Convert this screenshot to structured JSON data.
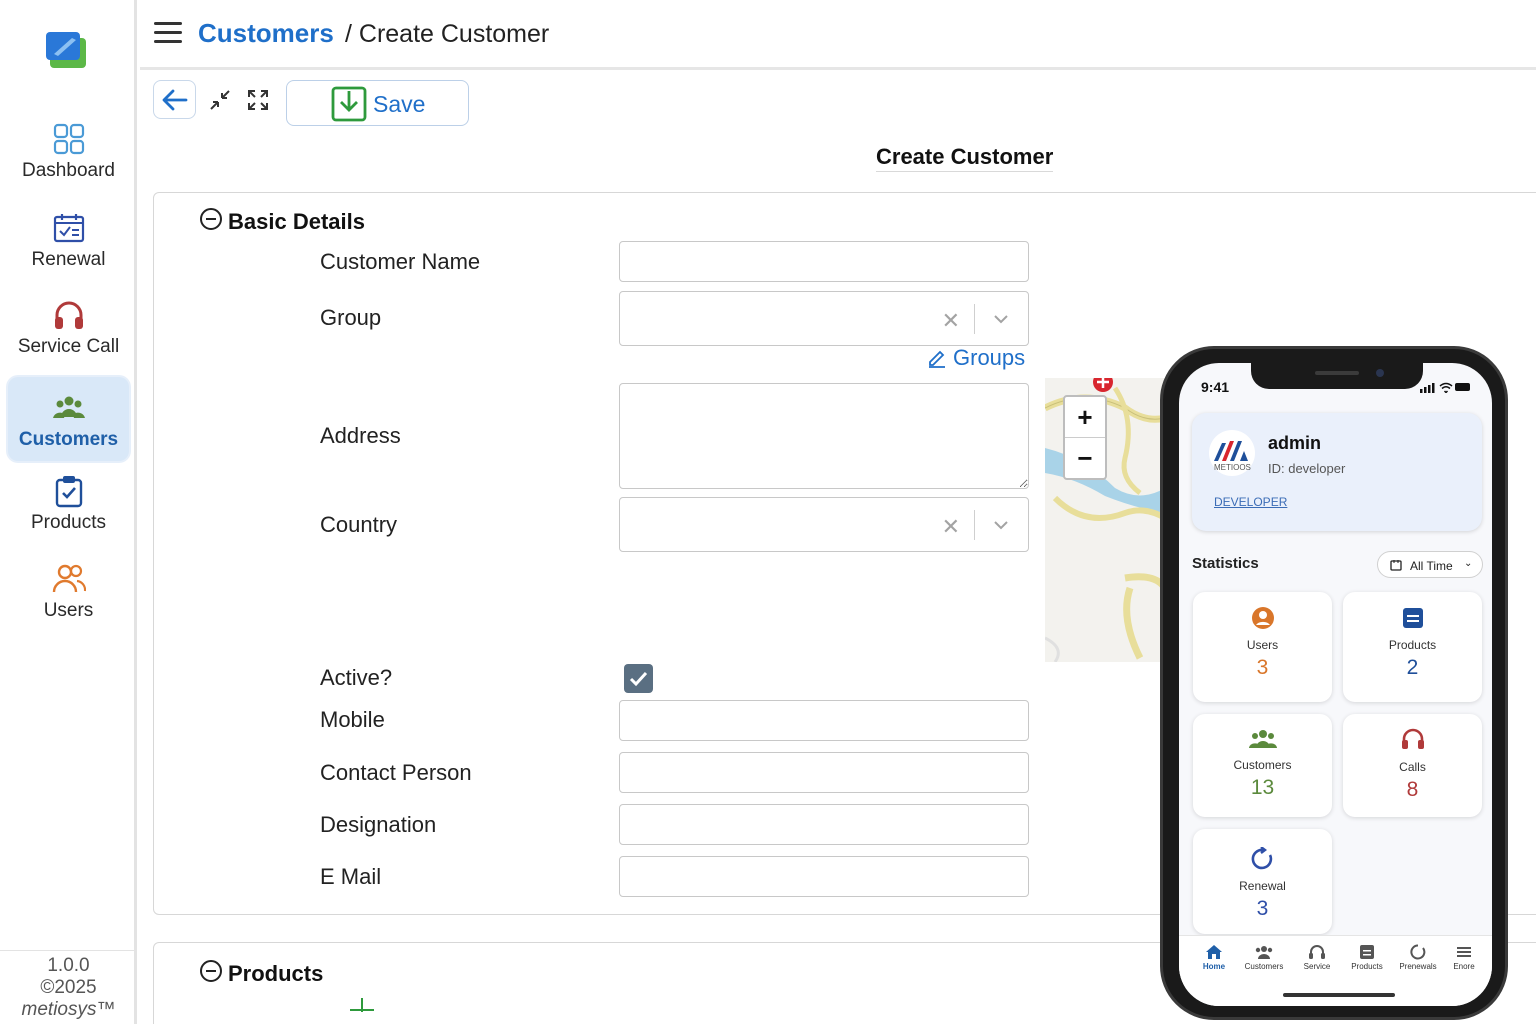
{
  "sidebar": {
    "items": [
      {
        "label": "Dashboard",
        "icon": "dashboard-grid-icon"
      },
      {
        "label": "Renewal",
        "icon": "calendar-icon"
      },
      {
        "label": "Service Call",
        "icon": "headset-icon"
      },
      {
        "label": "Customers",
        "icon": "people-group-icon",
        "active": true
      },
      {
        "label": "Products",
        "icon": "clipboard-check-icon"
      },
      {
        "label": "Users",
        "icon": "users-icon"
      }
    ],
    "version": "1.0.0",
    "copyright": "©2025",
    "brand": "metiosys™"
  },
  "header": {
    "breadcrumb_root": "Customers",
    "breadcrumb_current": "/ Create Customer"
  },
  "toolbar": {
    "save_label": "Save"
  },
  "page_title": "Create Customer",
  "sections": {
    "basic": "Basic Details",
    "products": "Products"
  },
  "form": {
    "customer_name": {
      "label": "Customer Name",
      "value": ""
    },
    "group": {
      "label": "Group",
      "value": ""
    },
    "groups_link": "Groups",
    "address": {
      "label": "Address",
      "value": ""
    },
    "country": {
      "label": "Country",
      "value": ""
    },
    "active": {
      "label": "Active?",
      "checked": true
    },
    "mobile": {
      "label": "Mobile",
      "value": ""
    },
    "contact_person": {
      "label": "Contact Person",
      "value": ""
    },
    "designation": {
      "label": "Designation",
      "value": ""
    },
    "email": {
      "label": "E Mail",
      "value": ""
    }
  },
  "map": {
    "zoom_in": "+",
    "zoom_out": "−"
  },
  "phone": {
    "time": "9:41",
    "profile": {
      "name": "admin",
      "id": "ID: developer",
      "role": "DEVELOPER",
      "brand": "METIOOS"
    },
    "stats_title": "Statistics",
    "filter": "All Time",
    "stats": [
      {
        "label": "Users",
        "value": "3",
        "color": "#d9762a"
      },
      {
        "label": "Products",
        "value": "2",
        "color": "#1f4f9a"
      },
      {
        "label": "Customers",
        "value": "13",
        "color": "#5b8a3c"
      },
      {
        "label": "Calls",
        "value": "8",
        "color": "#b03a3a"
      },
      {
        "label": "Renewal",
        "value": "3",
        "color": "#2f4fa8"
      }
    ],
    "tabs": [
      {
        "label": "Home",
        "active": true
      },
      {
        "label": "Customers"
      },
      {
        "label": "Service"
      },
      {
        "label": "Products"
      },
      {
        "label": "Prenewals"
      },
      {
        "label": "Enore"
      }
    ]
  }
}
